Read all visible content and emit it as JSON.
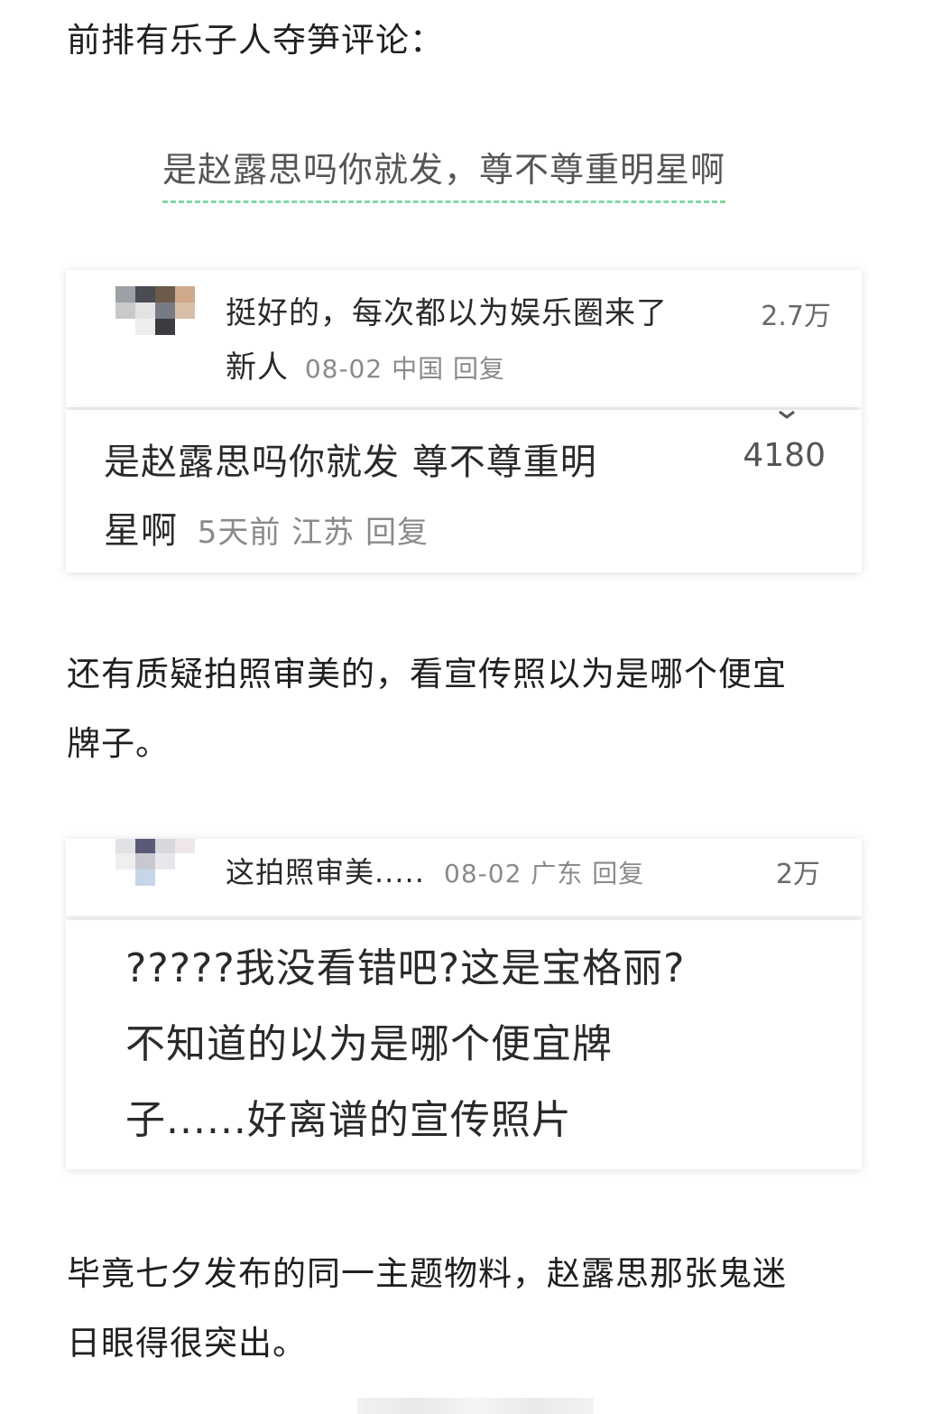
{
  "intro_text": "前排有乐子人夺笋评论：",
  "highlight_quote": "是赵露思吗你就发，尊不尊重明星啊",
  "comment_group_1": {
    "parent": {
      "text_line1": "挺好的，每次都以为娱乐圈来了",
      "text_line2": "新人",
      "meta": "08-02 中国 回复",
      "likes": "2.7万"
    },
    "reply": {
      "text_line1": "是赵露思吗你就发 尊不尊重明",
      "text_line2": "星啊",
      "meta": "5天前 江苏 回复",
      "likes": "4180"
    }
  },
  "paragraph_2_line1": "还有质疑拍照审美的，看宣传照以为是哪个便宜",
  "paragraph_2_line2": "牌子。",
  "comment_group_2": {
    "parent": {
      "text": "这拍照审美.....",
      "meta": "08-02 广东 回复",
      "likes": "2万"
    },
    "reply": {
      "line1": "?????我没看错吧?这是宝格丽?",
      "line2": "不知道的以为是哪个便宜牌",
      "line3": "子......好离谱的宣传照片"
    }
  },
  "paragraph_3_line1": "毕竟七夕发布的同一主题物料，赵露思那张鬼迷",
  "paragraph_3_line2": "日眼得很突出。",
  "colors": {
    "underline": "#86d6a2",
    "text": "#1f1f1f",
    "meta": "#8a8a8a"
  }
}
